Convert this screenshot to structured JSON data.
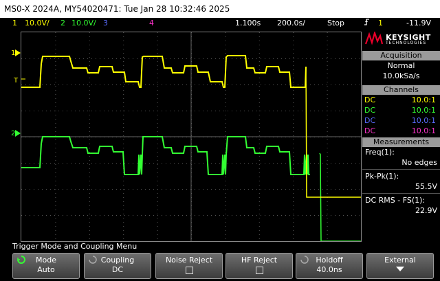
{
  "window_title": "MS0-X 2024A, MY54020471: Tue Jan 28 10:32:46 2025",
  "status": {
    "ch1_num": "1",
    "ch1_scale": "10.0V/",
    "ch2_num": "2",
    "ch2_scale": "10.0V/",
    "ch3_num": "3",
    "ch4_num": "4",
    "time_ref": "1.100s",
    "time_scale": "200.0s/",
    "run_state": "Stop",
    "trig_icon": "trigger-edge-icon",
    "trig_channel": "1",
    "trig_level": "-11.9V"
  },
  "markers": {
    "ch1": "1",
    "ch2": "2",
    "trig": "T"
  },
  "brand": {
    "name": "KEYSIGHT",
    "sub": "TECHNOLOGIES",
    "color": "#e8002a"
  },
  "acquisition": {
    "header": "Acquisition",
    "mode": "Normal",
    "rate": "10.0kSa/s"
  },
  "channels": {
    "header": "Channels",
    "rows": [
      {
        "coupling": "DC",
        "ratio": "10.0:1",
        "color": "#ffff00"
      },
      {
        "coupling": "DC",
        "ratio": "10.0:1",
        "color": "#33ff33"
      },
      {
        "coupling": "DC",
        "ratio": "10.0:1",
        "color": "#5a6cff"
      },
      {
        "coupling": "DC",
        "ratio": "10.0:1",
        "color": "#ff33cc"
      }
    ]
  },
  "measurements": {
    "header": "Measurements",
    "items": [
      {
        "label": "Freq(1):",
        "value": "No edges"
      },
      {
        "label": "Pk-Pk(1):",
        "value": "55.5V"
      },
      {
        "label": "DC RMS - FS(1):",
        "value": "22.9V"
      }
    ]
  },
  "menu": {
    "title": "Trigger Mode and Coupling Menu",
    "keys": [
      {
        "label": "Mode",
        "value": "Auto"
      },
      {
        "label": "Coupling",
        "value": "DC"
      },
      {
        "label": "Noise Reject",
        "value": ""
      },
      {
        "label": "HF Reject",
        "value": ""
      },
      {
        "label": "Holdoff",
        "value": "40.0ns"
      },
      {
        "label": "External",
        "value": ""
      }
    ]
  },
  "colors": {
    "ch1": "#ffff00",
    "ch2": "#33ff33",
    "ch3": "#5a6cff",
    "ch4": "#ff33cc",
    "panel_header": "#9a9a9a"
  }
}
